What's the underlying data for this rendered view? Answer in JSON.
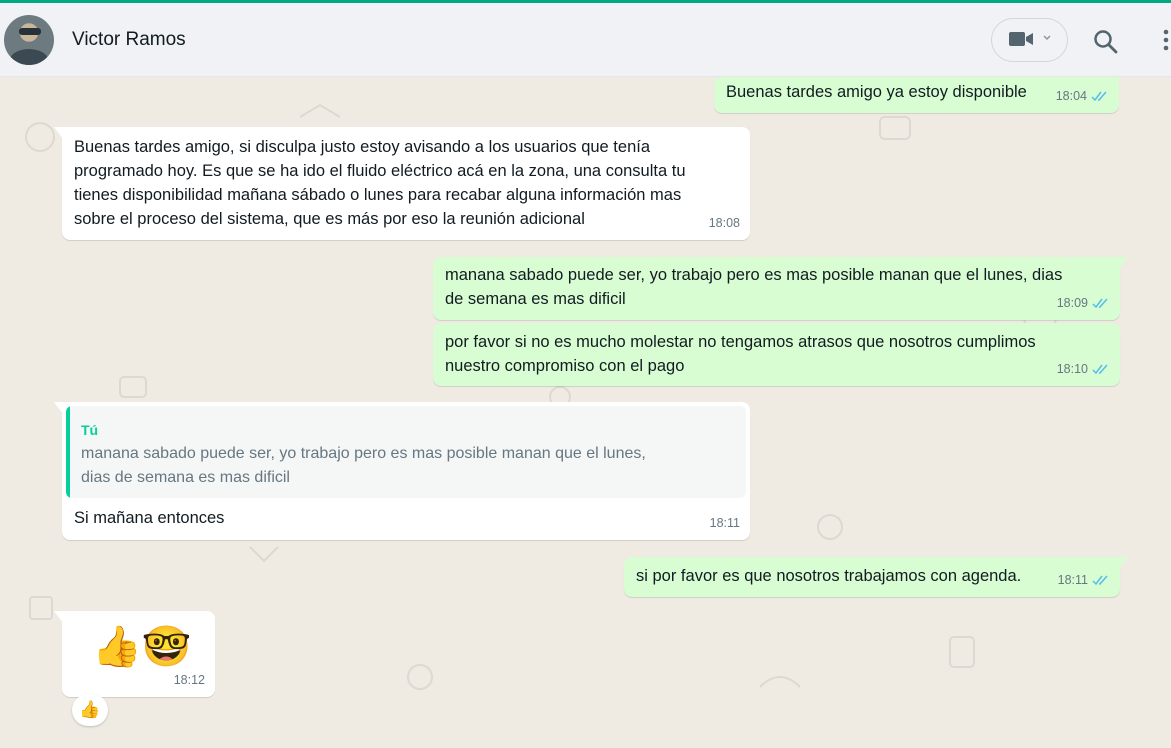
{
  "header": {
    "contact_name": "Victor Ramos",
    "avatar_icon": "contact-avatar",
    "video_icon": "video-camera-icon",
    "search_icon": "search-icon",
    "menu_icon": "menu-dots-icon"
  },
  "messages": [
    {
      "direction": "out",
      "text": "Buenas tardes amigo ya estoy disponible",
      "time": "18:04",
      "status": "read"
    },
    {
      "direction": "in",
      "text": "Buenas tardes amigo, si disculpa justo estoy avisando a los usuarios que tenía\nprogramado hoy. Es que se ha ido el fluido eléctrico acá en la zona, una consulta tu\ntienes disponibilidad mañana sábado o lunes para recabar alguna información mas\nsobre el proceso del sistema, que es más por eso la reunión adicional",
      "time": "18:08"
    },
    {
      "direction": "out",
      "text": "manana sabado puede ser, yo trabajo pero es mas posible manan que el lunes, dias\nde semana es mas dificil",
      "time": "18:09",
      "status": "read"
    },
    {
      "direction": "out",
      "text": "por favor si no es mucho molestar no tengamos atrasos que nosotros cumplimos\nnuestro compromiso con el pago",
      "time": "18:10",
      "status": "read"
    },
    {
      "direction": "in",
      "quote_author": "Tú",
      "quote_text": "manana sabado puede ser, yo trabajo pero es mas posible manan que el lunes,\ndias de semana es mas dificil",
      "text": "Si mañana entonces",
      "time": "18:11"
    },
    {
      "direction": "out",
      "text": "si por favor es que nosotros trabajamos con agenda.",
      "time": "18:11",
      "status": "read"
    },
    {
      "direction": "in",
      "text": "👍🤓",
      "time": "18:12",
      "reaction": "👍"
    }
  ],
  "colors": {
    "accent": "#00a884",
    "outgoing_bubble": "#d9fdd3",
    "incoming_bubble": "#ffffff",
    "chat_background": "#efeae2",
    "read_ticks": "#53bdeb"
  }
}
